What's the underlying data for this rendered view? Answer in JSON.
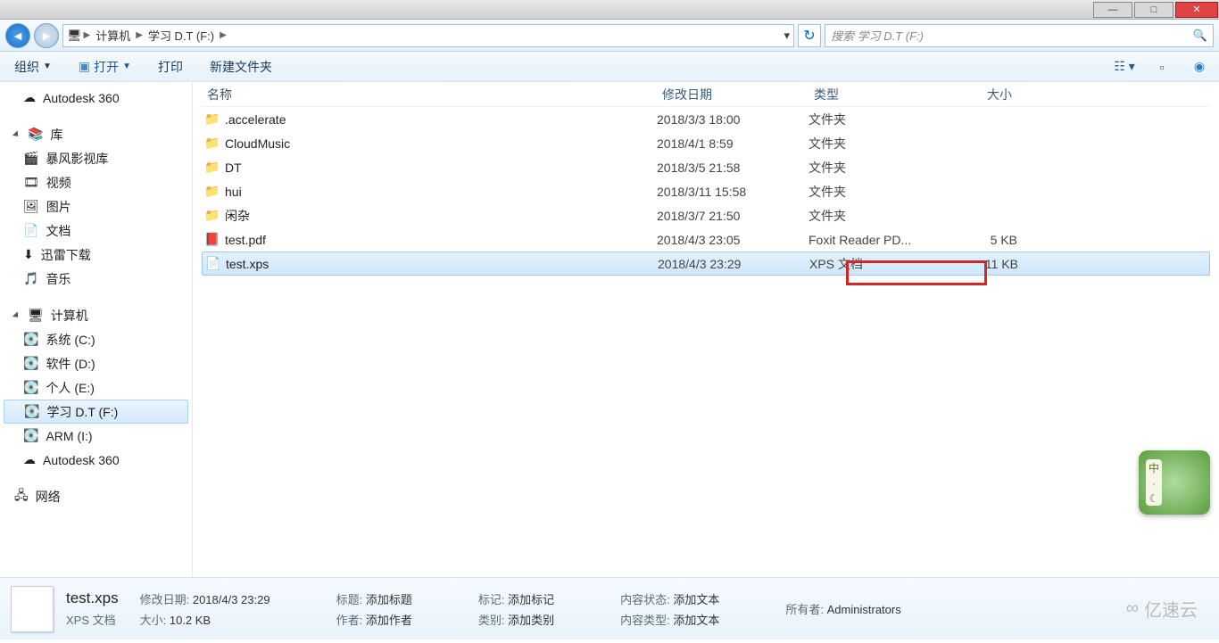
{
  "window": {
    "min": "—",
    "max": "□",
    "close": "✕"
  },
  "nav": {
    "segments": [
      "计算机",
      "学习 D.T (F:)"
    ],
    "search_placeholder": "搜索 学习 D.T (F:)"
  },
  "toolbar": {
    "organize": "组织",
    "open": "打开",
    "print": "打印",
    "newfolder": "新建文件夹"
  },
  "sidebar": {
    "autodesk": "Autodesk 360",
    "libraries": "库",
    "lib_items": [
      "暴风影视库",
      "视频",
      "图片",
      "文档",
      "迅雷下载",
      "音乐"
    ],
    "computer": "计算机",
    "drives": [
      "系统 (C:)",
      "软件 (D:)",
      "个人 (E:)",
      "学习 D.T (F:)",
      "ARM  (I:)",
      "Autodesk 360"
    ],
    "drive_selected_index": 3,
    "network": "网络"
  },
  "columns": {
    "name": "名称",
    "date": "修改日期",
    "type": "类型",
    "size": "大小"
  },
  "files": [
    {
      "icon": "folder",
      "name": ".accelerate",
      "date": "2018/3/3 18:00",
      "type": "文件夹",
      "size": ""
    },
    {
      "icon": "folder",
      "name": "CloudMusic",
      "date": "2018/4/1 8:59",
      "type": "文件夹",
      "size": ""
    },
    {
      "icon": "folder",
      "name": "DT",
      "date": "2018/3/5 21:58",
      "type": "文件夹",
      "size": ""
    },
    {
      "icon": "folder",
      "name": "hui",
      "date": "2018/3/11 15:58",
      "type": "文件夹",
      "size": ""
    },
    {
      "icon": "folder",
      "name": "闲杂",
      "date": "2018/3/7 21:50",
      "type": "文件夹",
      "size": ""
    },
    {
      "icon": "pdf",
      "name": "test.pdf",
      "date": "2018/4/3 23:05",
      "type": "Foxit Reader PD...",
      "size": "5 KB"
    },
    {
      "icon": "xps",
      "name": "test.xps",
      "date": "2018/4/3 23:29",
      "type": "XPS 文档",
      "size": "11 KB"
    }
  ],
  "selected_file_index": 6,
  "details": {
    "name": "test.xps",
    "line2_label": "XPS 文档",
    "mod_label": "修改日期:",
    "mod": "2018/4/3 23:29",
    "size_label": "大小:",
    "size": "10.2 KB",
    "title_label": "标题:",
    "title": "添加标题",
    "author_label": "作者:",
    "author": "添加作者",
    "tag_label": "标记:",
    "tag": "添加标记",
    "cat_label": "类别:",
    "cat": "添加类别",
    "cstate_label": "内容状态:",
    "cstate": "添加文本",
    "ctype_label": "内容类型:",
    "ctype": "添加文本",
    "owner_label": "所有者:",
    "owner": "Administrators"
  },
  "watermark": "亿速云",
  "ime": "中"
}
